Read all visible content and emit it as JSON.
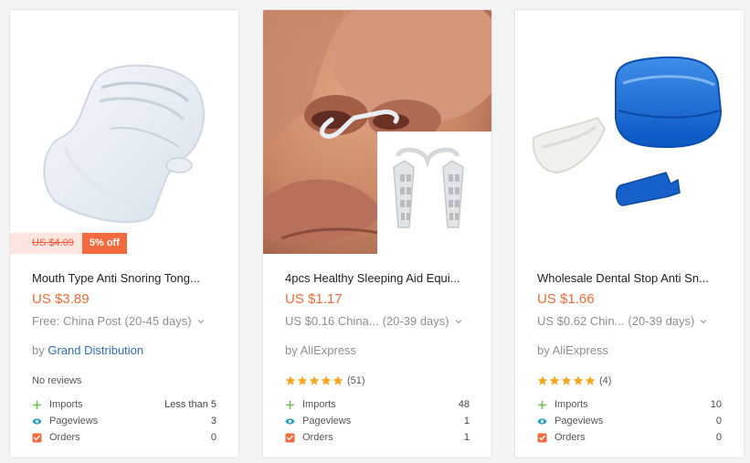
{
  "products": [
    {
      "old_price": "US $4.09",
      "discount": "5% off",
      "title": "Mouth Type Anti Snoring Tong...",
      "price": "US $3.89",
      "shipping_main": "Free: China Post",
      "shipping_days": "(20-45 days)",
      "by_prefix": "by",
      "seller": "Grand Distribution",
      "reviews_text": "No reviews",
      "stats": [
        {
          "label": "Imports",
          "value": "Less than 5"
        },
        {
          "label": "Pageviews",
          "value": "3"
        },
        {
          "label": "Orders",
          "value": "0"
        }
      ]
    },
    {
      "title": "4pcs Healthy Sleeping Aid Equi...",
      "price": "US $1.17",
      "shipping_main": "US $0.16 China...",
      "shipping_days": "(20-39 days)",
      "by_prefix": "by",
      "seller": "AliExpress",
      "rating": 5,
      "reviews_count": "(51)",
      "stats": [
        {
          "label": "Imports",
          "value": "48"
        },
        {
          "label": "Pageviews",
          "value": "1"
        },
        {
          "label": "Orders",
          "value": "1"
        }
      ]
    },
    {
      "title": "Wholesale Dental Stop Anti Sn...",
      "price": "US $1.66",
      "shipping_main": "US $0.62 Chin...",
      "shipping_days": "(20-39 days)",
      "by_prefix": "by",
      "seller": "AliExpress",
      "rating": 5,
      "reviews_count": "(4)",
      "stats": [
        {
          "label": "Imports",
          "value": "10"
        },
        {
          "label": "Pageviews",
          "value": "0"
        },
        {
          "label": "Orders",
          "value": "0"
        }
      ]
    }
  ],
  "colors": {
    "price": "#f06a35",
    "seller_link": "#2f6fb6",
    "star": "#f7a823",
    "imports_icon": "#6cc24a",
    "pageviews_icon": "#1fa0c8",
    "orders_icon": "#f26a3d"
  },
  "icons": {
    "imports": "plus-icon",
    "pageviews": "eye-icon",
    "orders": "cart-icon",
    "shipping": "chevron-down-icon",
    "rating": "star-icon"
  }
}
